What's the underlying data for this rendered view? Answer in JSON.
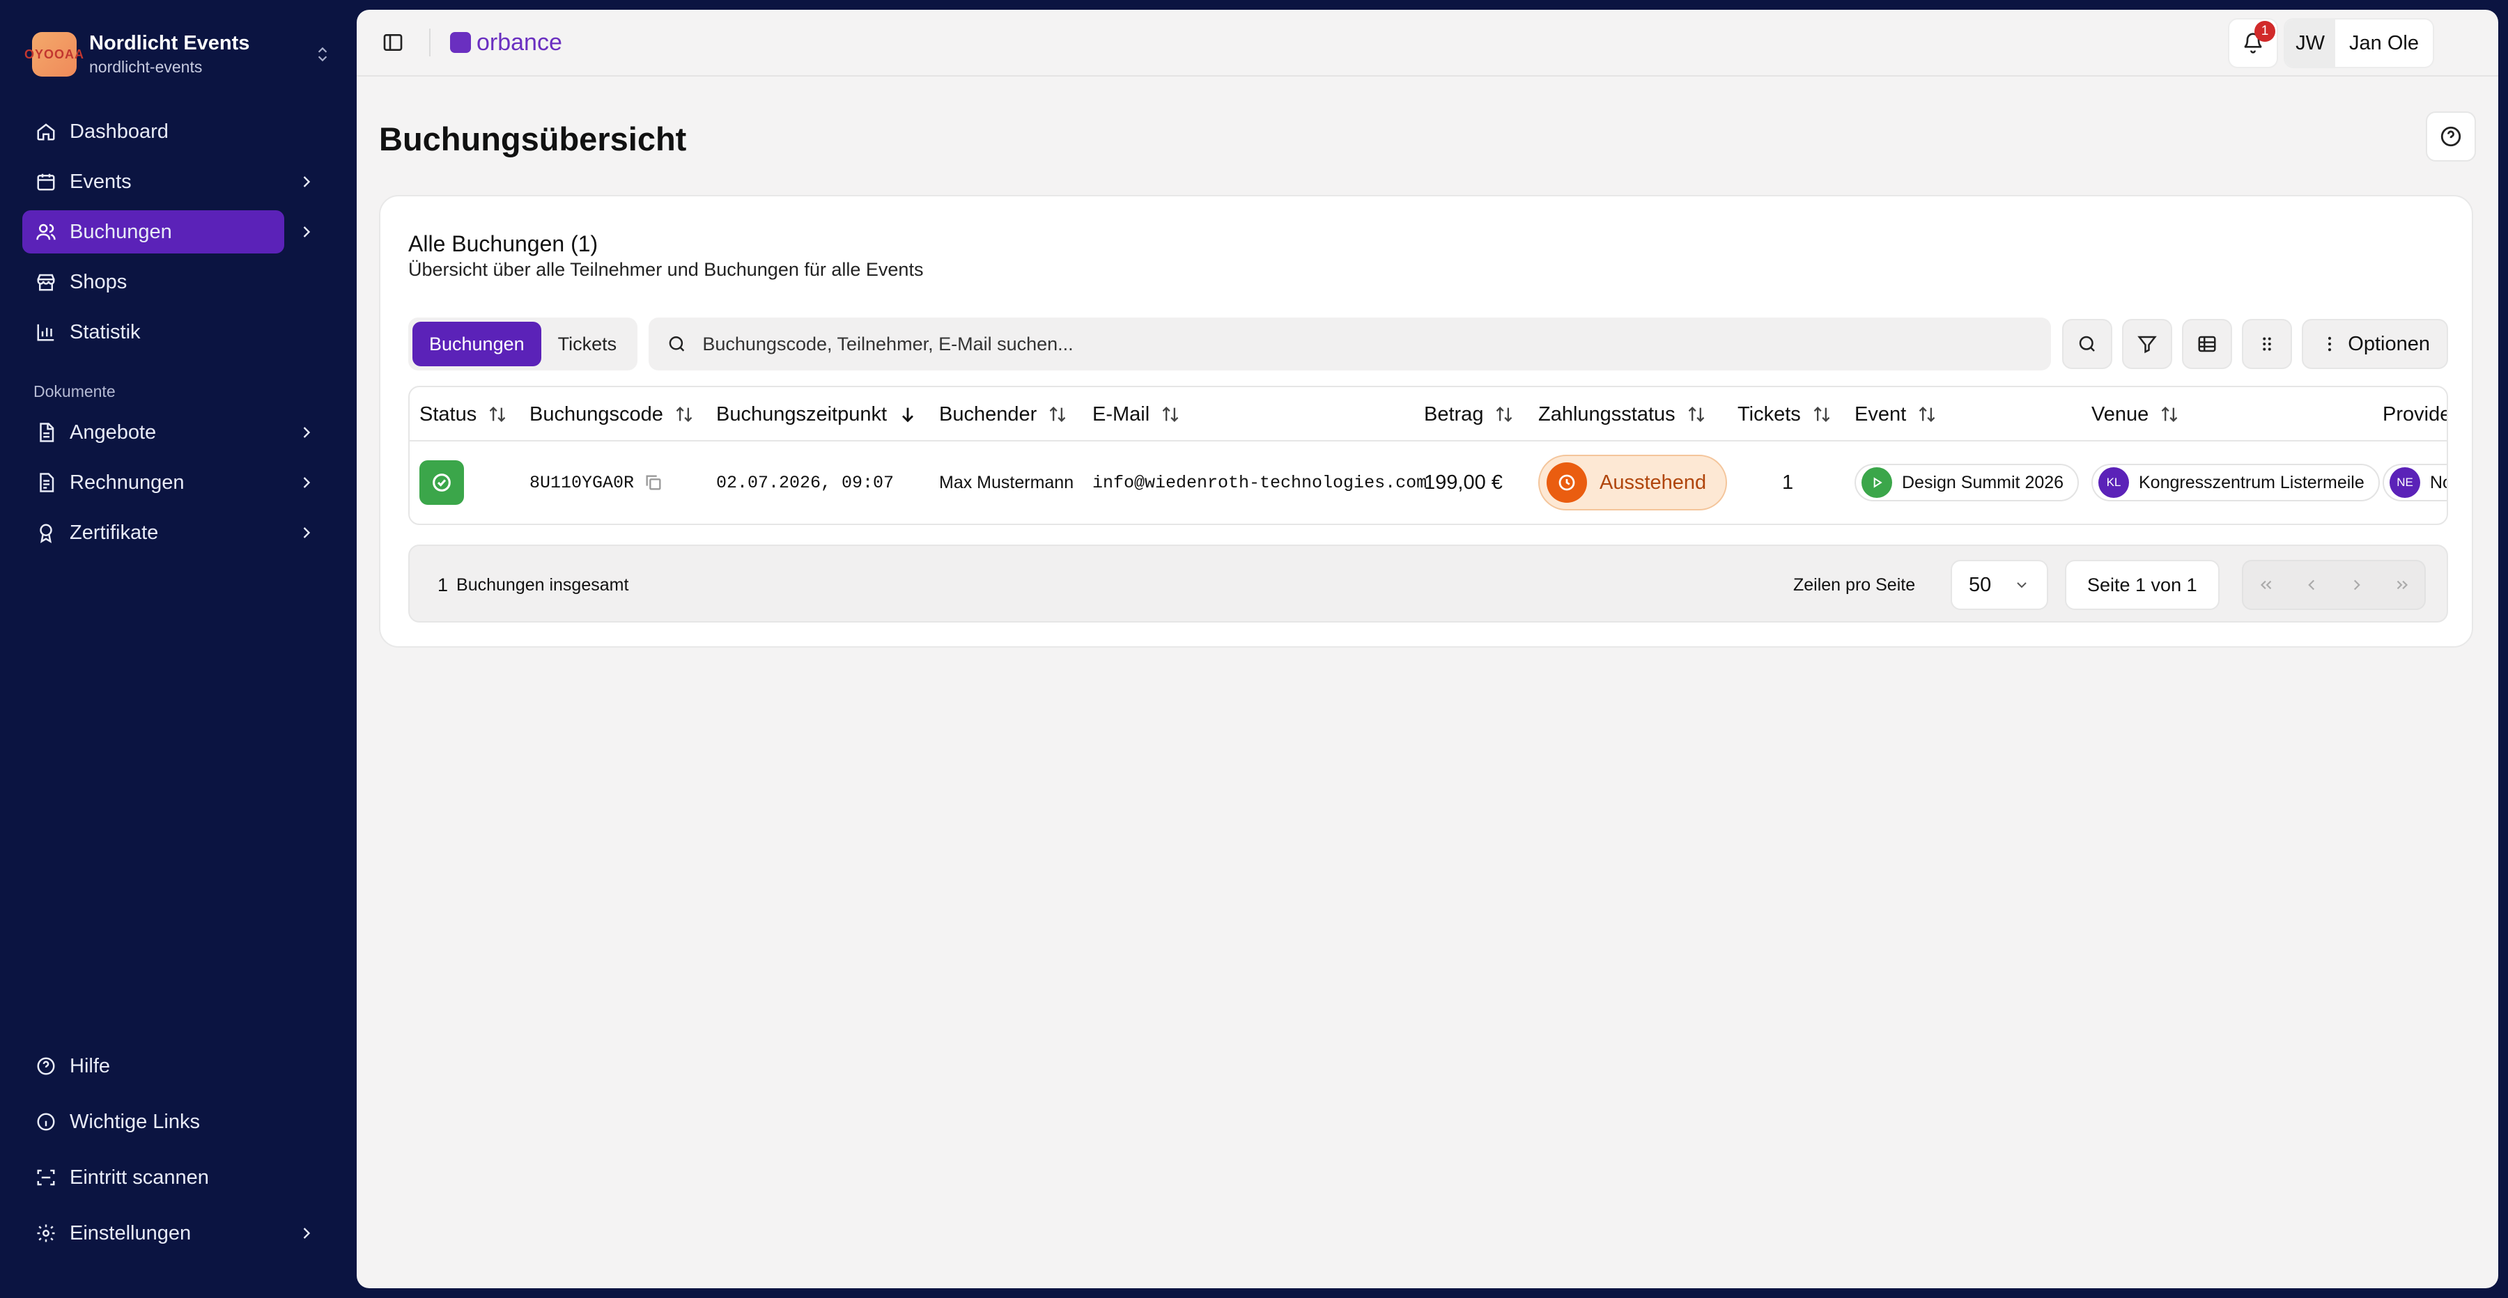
{
  "org": {
    "logo_text": "OYOOAA",
    "name": "Nordlicht Events",
    "slug": "nordlicht-events"
  },
  "nav": {
    "main": [
      {
        "label": "Dashboard",
        "icon": "home-icon",
        "chevron": false,
        "active": false
      },
      {
        "label": "Events",
        "icon": "calendar-icon",
        "chevron": true,
        "active": false
      },
      {
        "label": "Buchungen",
        "icon": "users-icon",
        "chevron": true,
        "active": true
      },
      {
        "label": "Shops",
        "icon": "store-icon",
        "chevron": false,
        "active": false
      },
      {
        "label": "Statistik",
        "icon": "bar-chart-icon",
        "chevron": false,
        "active": false
      }
    ],
    "section_label": "Dokumente",
    "docs": [
      {
        "label": "Angebote",
        "icon": "document-icon",
        "chevron": true
      },
      {
        "label": "Rechnungen",
        "icon": "receipt-icon",
        "chevron": true
      },
      {
        "label": "Zertifikate",
        "icon": "award-icon",
        "chevron": true
      }
    ],
    "bottom": [
      {
        "label": "Hilfe",
        "icon": "help-circle-icon",
        "chevron": false
      },
      {
        "label": "Wichtige Links",
        "icon": "info-icon",
        "chevron": false
      },
      {
        "label": "Eintritt scannen",
        "icon": "scan-icon",
        "chevron": false
      },
      {
        "label": "Einstellungen",
        "icon": "settings-icon",
        "chevron": true
      }
    ]
  },
  "topbar": {
    "brand": "orbance",
    "notifications_count": "1",
    "user_initials": "JW",
    "user_name": "Jan Ole"
  },
  "page": {
    "title": "Buchungsübersicht"
  },
  "card": {
    "title": "Alle Buchungen (1)",
    "subtitle": "Übersicht über alle Teilnehmer und Buchungen für alle Events",
    "tabs": [
      {
        "label": "Buchungen",
        "active": true
      },
      {
        "label": "Tickets",
        "active": false
      }
    ],
    "search_placeholder": "Buchungscode, Teilnehmer, E-Mail suchen...",
    "options_label": "Optionen"
  },
  "table": {
    "columns": [
      "Status",
      "Buchungscode",
      "Buchungszeitpunkt",
      "Buchender",
      "E-Mail",
      "Betrag",
      "Zahlungsstatus",
      "Tickets",
      "Event",
      "Venue",
      "Provide"
    ],
    "rows": [
      {
        "buchungscode": "8U110YGA0R",
        "zeitpunkt": "02.07.2026, 09:07",
        "buchender": "Max Mustermann",
        "email": "info@wiedenroth-technologies.com",
        "betrag": "199,00 €",
        "zahlungsstatus": "Ausstehend",
        "tickets": "1",
        "event": "Design Summit 2026",
        "venue_initials": "KL",
        "venue": "Kongresszentrum Listermeile",
        "provider_initials": "NE",
        "provider": "No"
      }
    ]
  },
  "footer": {
    "total_count": "1",
    "total_label": "Buchungen insgesamt",
    "rows_label": "Zeilen pro Seite",
    "rows_value": "50",
    "page_info": "Seite 1 von 1"
  },
  "colors": {
    "sidebar_bg": "#0b1441",
    "accent": "#5b22b8",
    "success": "#3ba64a",
    "pending": "#ea5d10"
  }
}
